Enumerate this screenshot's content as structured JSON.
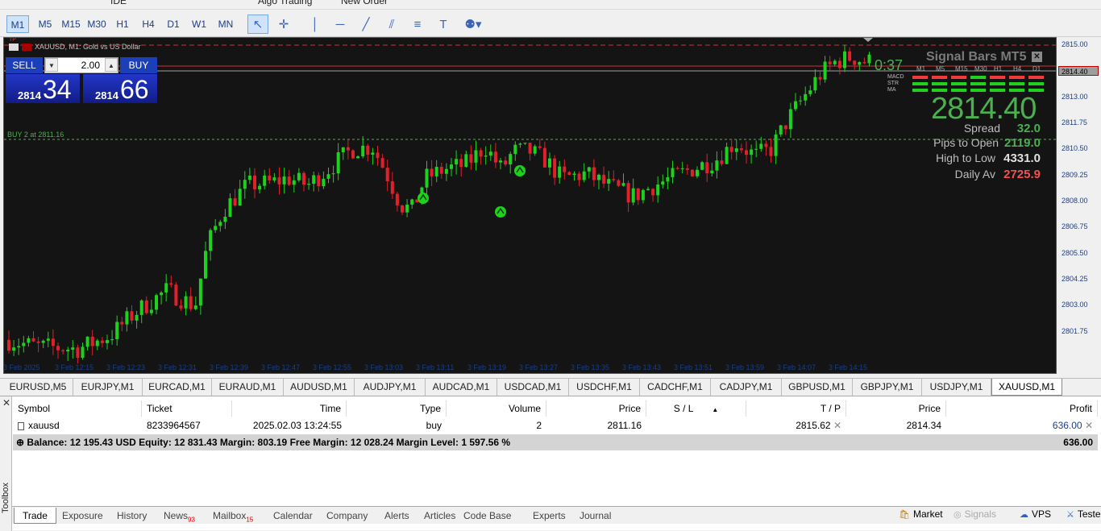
{
  "top_toolbar": {
    "algo_trading": "Algo Trading",
    "new_order": "New Order",
    "ide": "IDE"
  },
  "timeframes": [
    "M1",
    "M5",
    "M15",
    "M30",
    "H1",
    "H4",
    "D1",
    "W1",
    "MN"
  ],
  "active_timeframe": "M1",
  "chart": {
    "title": "XAUUSD, M1:  Gold vs US Dollar",
    "tp_label": "TP",
    "buy_line_label": "BUY 2 at 2811.16",
    "price_labels": [
      "2815.00",
      "2814.40",
      "2813.00",
      "2811.75",
      "2810.50",
      "2809.25",
      "2808.00",
      "2806.75",
      "2805.50",
      "2804.25",
      "2803.00",
      "2801.75"
    ],
    "current_price_label": "2814.40",
    "time_labels": [
      "3 Feb 2025",
      "3 Feb 12:15",
      "3 Feb 12:23",
      "3 Feb 12:31",
      "3 Feb 12:39",
      "3 Feb 12:47",
      "3 Feb 12:55",
      "3 Feb 13:03",
      "3 Feb 13:11",
      "3 Feb 13:19",
      "3 Feb 13:27",
      "3 Feb 13:35",
      "3 Feb 13:43",
      "3 Feb 13:51",
      "3 Feb 13:59",
      "3 Feb 14:07",
      "3 Feb 14:15"
    ],
    "colors": {
      "bull": "#1ed11e",
      "bear": "#e0202a",
      "background": "#141414",
      "price_line": "#d32f2f",
      "buy_line": "#4caf50"
    }
  },
  "one_click": {
    "sell_label": "SELL",
    "buy_label": "BUY",
    "lot": "2.00",
    "sell_price_small": "2814",
    "sell_price_big": "34",
    "buy_price_small": "2814",
    "buy_price_big": "66"
  },
  "signal_panel": {
    "title": "Signal Bars MT5",
    "timer": "0:37",
    "timeframes": [
      "M1",
      "M5",
      "M15",
      "M30",
      "H1",
      "H4",
      "D1"
    ],
    "rows": [
      "MACD",
      "STR",
      "MA"
    ],
    "price": "2814.40",
    "spread_label": "Spread",
    "spread_value": "32.0",
    "pips_label": "Pips to Open",
    "pips_value": "2119.0",
    "hl_label": "High to Low",
    "hl_value": "4331.0",
    "daily_label": "Daily Av",
    "daily_value": "2725.9"
  },
  "symbol_tabs": [
    "EURUSD,M5",
    "EURJPY,M1",
    "EURCAD,M1",
    "EURAUD,M1",
    "AUDUSD,M1",
    "AUDJPY,M1",
    "AUDCAD,M1",
    "USDCAD,M1",
    "USDCHF,M1",
    "CADCHF,M1",
    "CADJPY,M1",
    "GBPUSD,M1",
    "GBPJPY,M1",
    "USDJPY,M1",
    "XAUUSD,M1"
  ],
  "active_symbol_tab": "XAUUSD,M1",
  "trade_table": {
    "headers": [
      "Symbol",
      "Ticket",
      "Time",
      "Type",
      "Volume",
      "Price",
      "S / L",
      "T / P",
      "Price",
      "Profit"
    ],
    "row": {
      "symbol": "xauusd",
      "ticket": "8233964567",
      "time": "2025.02.03 13:24:55",
      "type": "buy",
      "volume": "2",
      "price": "2811.16",
      "sl": "",
      "tp": "2815.62",
      "current_price": "2814.34",
      "profit": "636.00"
    },
    "balance_text": "Balance: 12 195.43 USD  Equity: 12 831.43  Margin: 803.19  Free Margin: 12 028.24  Margin Level: 1 597.56 %",
    "balance_profit": "636.00"
  },
  "toolbox_label": "Toolbox",
  "bottom_tabs": [
    {
      "label": "Trade",
      "badge": ""
    },
    {
      "label": "Exposure",
      "badge": ""
    },
    {
      "label": "History",
      "badge": ""
    },
    {
      "label": "News",
      "badge": "93"
    },
    {
      "label": "Mailbox",
      "badge": "15"
    },
    {
      "label": "Calendar",
      "badge": ""
    },
    {
      "label": "Company",
      "badge": ""
    },
    {
      "label": "Alerts",
      "badge": ""
    },
    {
      "label": "Articles",
      "badge": ""
    },
    {
      "label": "Code Base",
      "badge": ""
    },
    {
      "label": "Experts",
      "badge": ""
    },
    {
      "label": "Journal",
      "badge": ""
    }
  ],
  "bottom_right": {
    "market": "Market",
    "signals": "Signals",
    "vps": "VPS",
    "tester": "Tester"
  }
}
